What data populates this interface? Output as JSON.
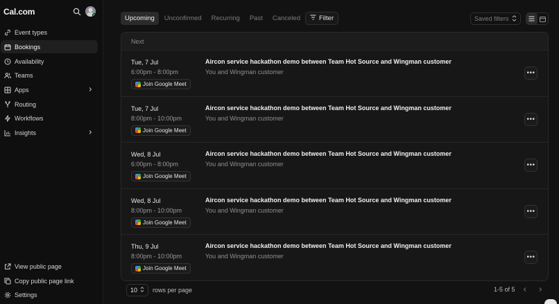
{
  "app": {
    "brand": "Cal.com"
  },
  "sidebar": {
    "items": [
      {
        "label": "Event types",
        "icon": "link-icon"
      },
      {
        "label": "Bookings",
        "icon": "calendar-icon",
        "active": true
      },
      {
        "label": "Availability",
        "icon": "clock-icon"
      },
      {
        "label": "Teams",
        "icon": "users-icon"
      },
      {
        "label": "Apps",
        "icon": "grid-icon",
        "has_chevron": true
      },
      {
        "label": "Routing",
        "icon": "routing-icon"
      },
      {
        "label": "Workflows",
        "icon": "zap-icon"
      },
      {
        "label": "Insights",
        "icon": "chart-icon",
        "has_chevron": true
      }
    ],
    "bottom_items": [
      {
        "label": "View public page",
        "icon": "external-link-icon"
      },
      {
        "label": "Copy public page link",
        "icon": "copy-icon"
      },
      {
        "label": "Settings",
        "icon": "gear-icon"
      }
    ]
  },
  "tabs": [
    {
      "label": "Upcoming",
      "active": true
    },
    {
      "label": "Unconfirmed"
    },
    {
      "label": "Recurring"
    },
    {
      "label": "Past"
    },
    {
      "label": "Canceled"
    }
  ],
  "toolbar": {
    "filter_label": "Filter",
    "saved_filters_placeholder": "Saved filters"
  },
  "list": {
    "section_label": "Next",
    "meet_label": "Join Google Meet",
    "bookings": [
      {
        "date": "Tue, 7 Jul",
        "time": "6:00pm - 8:00pm",
        "title": "Aircon service hackathon demo between Team Hot Source and Wingman customer",
        "attendees": "You and Wingman customer"
      },
      {
        "date": "Tue, 7 Jul",
        "time": "8:00pm - 10:00pm",
        "title": "Aircon service hackathon demo between Team Hot Source and Wingman customer",
        "attendees": "You and Wingman customer"
      },
      {
        "date": "Wed, 8 Jul",
        "time": "6:00pm - 8:00pm",
        "title": "Aircon service hackathon demo between Team Hot Source and Wingman customer",
        "attendees": "You and Wingman customer"
      },
      {
        "date": "Wed, 8 Jul",
        "time": "8:00pm - 10:00pm",
        "title": "Aircon service hackathon demo between Team Hot Source and Wingman customer",
        "attendees": "You and Wingman customer"
      },
      {
        "date": "Thu, 9 Jul",
        "time": "8:00pm - 10:00pm",
        "title": "Aircon service hackathon demo between Team Hot Source and Wingman customer",
        "attendees": "You and Wingman customer"
      }
    ]
  },
  "pagination": {
    "rows_per_page_value": "10",
    "rows_per_page_label": "rows per page",
    "range": "1-5 of 5"
  },
  "colors": {
    "background": "#121212",
    "sidebar": "#0f0f0f",
    "active_tab": "#2b2b2b",
    "online_dot": "#22c55e"
  }
}
